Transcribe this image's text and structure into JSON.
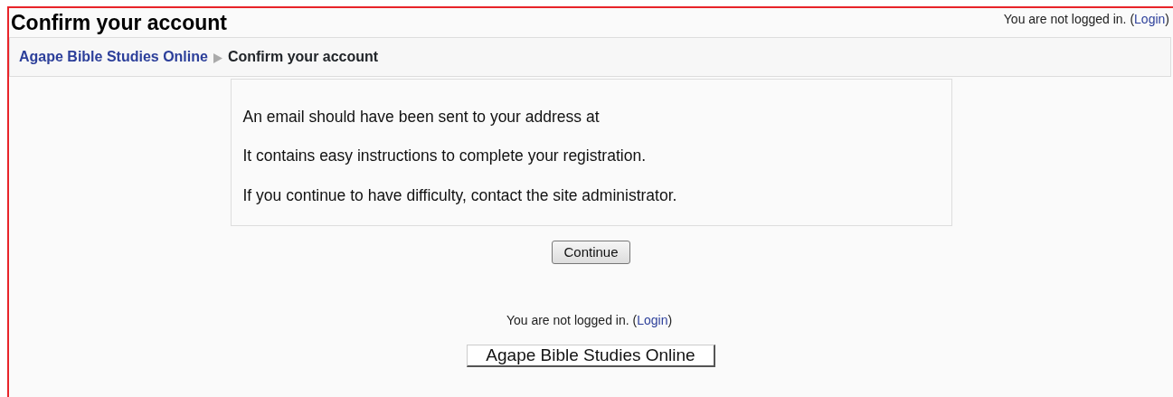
{
  "header": {
    "title": "Confirm your account",
    "login_info": {
      "before": "You are not logged in. (",
      "link": "Login",
      "after": ")"
    }
  },
  "breadcrumb": {
    "items": [
      {
        "label": "Agape Bible Studies Online",
        "kind": "link"
      },
      {
        "label": "Confirm your account",
        "kind": "current"
      }
    ]
  },
  "message": {
    "lines": [
      "An email should have been sent to your address at",
      "It contains easy instructions to complete your registration.",
      "If you continue to have difficulty, contact the site administrator."
    ]
  },
  "buttons": [
    "Continue"
  ],
  "footer": {
    "login_info": {
      "before": "You are not logged in. (",
      "link": "Login",
      "after": ")"
    },
    "home_button": "Agape Bible Studies Online"
  }
}
